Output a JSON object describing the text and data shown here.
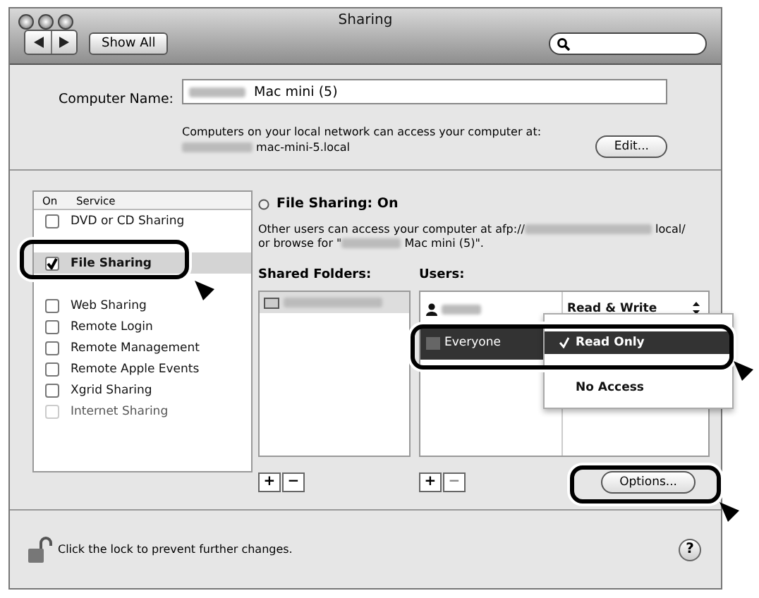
{
  "window": {
    "title": "Sharing"
  },
  "toolbar": {
    "show_all": "Show All"
  },
  "computer_name": {
    "label": "Computer Name:",
    "value": "Mac mini (5)",
    "note": "Computers on your local network can access your computer at:",
    "address": "mac-mini-5.local",
    "edit_button": "Edit..."
  },
  "services": {
    "columns": [
      "On",
      "Service"
    ],
    "items": [
      {
        "kind": "row",
        "name": "DVD or CD Sharing",
        "checked": false,
        "selected": false,
        "disabled": false
      },
      {
        "kind": "covered"
      },
      {
        "kind": "row",
        "name": "File Sharing",
        "checked": true,
        "selected": true,
        "disabled": false
      },
      {
        "kind": "covered"
      },
      {
        "kind": "row",
        "name": "Web Sharing",
        "checked": false,
        "selected": false,
        "disabled": false
      },
      {
        "kind": "row",
        "name": "Remote Login",
        "checked": false,
        "selected": false,
        "disabled": false
      },
      {
        "kind": "row",
        "name": "Remote Management",
        "checked": false,
        "selected": false,
        "disabled": false
      },
      {
        "kind": "row",
        "name": "Remote Apple Events",
        "checked": false,
        "selected": false,
        "disabled": false
      },
      {
        "kind": "row",
        "name": "Xgrid Sharing",
        "checked": false,
        "selected": false,
        "disabled": false
      },
      {
        "kind": "row",
        "name": "Internet Sharing",
        "checked": false,
        "selected": false,
        "disabled": true
      }
    ]
  },
  "status": {
    "title": "File Sharing: On",
    "line_1": "Other users can access your computer at afp://",
    "line_1_end": "local/",
    "line_2": "or browse for \"",
    "line_2_end": "Mac mini (5)\"."
  },
  "shared_folders": {
    "label": "Shared Folders:",
    "items": [
      {
        "selected": true
      }
    ]
  },
  "users": {
    "label": "Users:",
    "items": [
      {
        "kind": "user",
        "access": "Read & Write",
        "selected": false
      },
      {
        "kind": "group",
        "name": "Everyone",
        "selected": true
      }
    ]
  },
  "access_menu": {
    "items": [
      {
        "label": "Read Only",
        "checked": true,
        "selected": true
      },
      {
        "label": "No Access",
        "checked": false,
        "selected": false
      }
    ]
  },
  "list_buttons": {
    "add": "+",
    "remove": "−"
  },
  "options_button": "Options...",
  "footer": {
    "lock_text": "Click the lock to prevent further changes.",
    "help": "?"
  }
}
